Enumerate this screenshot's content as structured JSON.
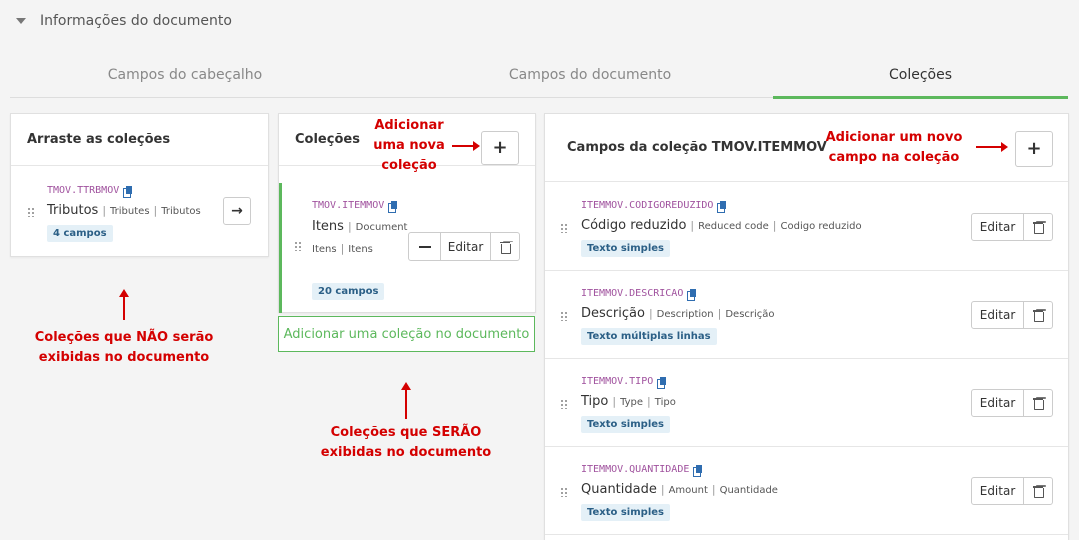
{
  "header": {
    "title": "Informações do documento"
  },
  "tabs": [
    {
      "label": "Campos do cabeçalho"
    },
    {
      "label": "Campos do documento"
    },
    {
      "label": "Coleções"
    }
  ],
  "left_panel": {
    "title": "Arraste as coleções",
    "item": {
      "code": "TMOV.TTRBMOV",
      "name": "Tributos",
      "en": "Tributes",
      "alt": "Tributos",
      "badge": "4 campos"
    }
  },
  "mid_panel": {
    "title": "Coleções",
    "add_label": "+",
    "item": {
      "code": "TMOV.ITEMMOV",
      "name": "Itens",
      "en": "Document",
      "sub": "Itens",
      "alt": "Itens",
      "badge": "20 campos",
      "edit_label": "Editar"
    },
    "add_collection_label": "Adicionar uma coleção no documento"
  },
  "right_panel": {
    "title": "Campos da coleção TMOV.ITEMMOV",
    "add_label": "+",
    "edit_label": "Editar",
    "fields": [
      {
        "code": "ITEMMOV.CODIGOREDUZIDO",
        "name": "Código reduzido",
        "en": "Reduced code",
        "alt": "Codigo reduzido",
        "type": "Texto simples"
      },
      {
        "code": "ITEMMOV.DESCRICAO",
        "name": "Descrição",
        "en": "Description",
        "alt": "Descrição",
        "type": "Texto múltiplas linhas"
      },
      {
        "code": "ITEMMOV.TIPO",
        "name": "Tipo",
        "en": "Type",
        "alt": "Tipo",
        "type": "Texto simples"
      },
      {
        "code": "ITEMMOV.QUANTIDADE",
        "name": "Quantidade",
        "en": "Amount",
        "alt": "Quantidade",
        "type": "Texto simples"
      }
    ]
  },
  "annotations": {
    "add_new_collection": "Adicionar uma nova coleção",
    "add_new_field": "Adicionar um novo campo na coleção",
    "not_shown": "Coleções que NÃO serão exibidas no documento",
    "shown": "Coleções que SERÃO exibidas no documento"
  },
  "colors": {
    "accent": "#5cb85c",
    "annotation": "#d40000",
    "code": "#a0529e",
    "badge_bg": "#e4f0f7"
  }
}
